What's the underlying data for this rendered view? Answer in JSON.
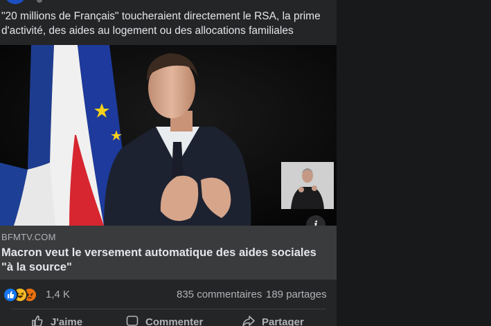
{
  "post": {
    "text": "\"20 millions de Français\" toucheraient directement le RSA, la prime d'activité, des aides au logement ou des allocations familiales"
  },
  "media": {
    "info_label": "i"
  },
  "link": {
    "domain": "BFMTV.COM",
    "title": "Macron veut le versement automatique des aides sociales \"à la source\""
  },
  "reactions": {
    "icons": [
      "like-reaction",
      "haha-reaction",
      "angry-reaction"
    ],
    "count": "1,4 K",
    "comments": "835 commentaires",
    "shares": "189 partages"
  },
  "actions": {
    "like_label": "J'aime",
    "comment_label": "Commenter",
    "share_label": "Partager"
  },
  "colors": {
    "background": "#18191a",
    "card": "#242526",
    "preview": "#3a3b3c",
    "text_primary": "#e4e6eb",
    "text_secondary": "#b0b3b8",
    "like_blue": "#1877f2"
  }
}
